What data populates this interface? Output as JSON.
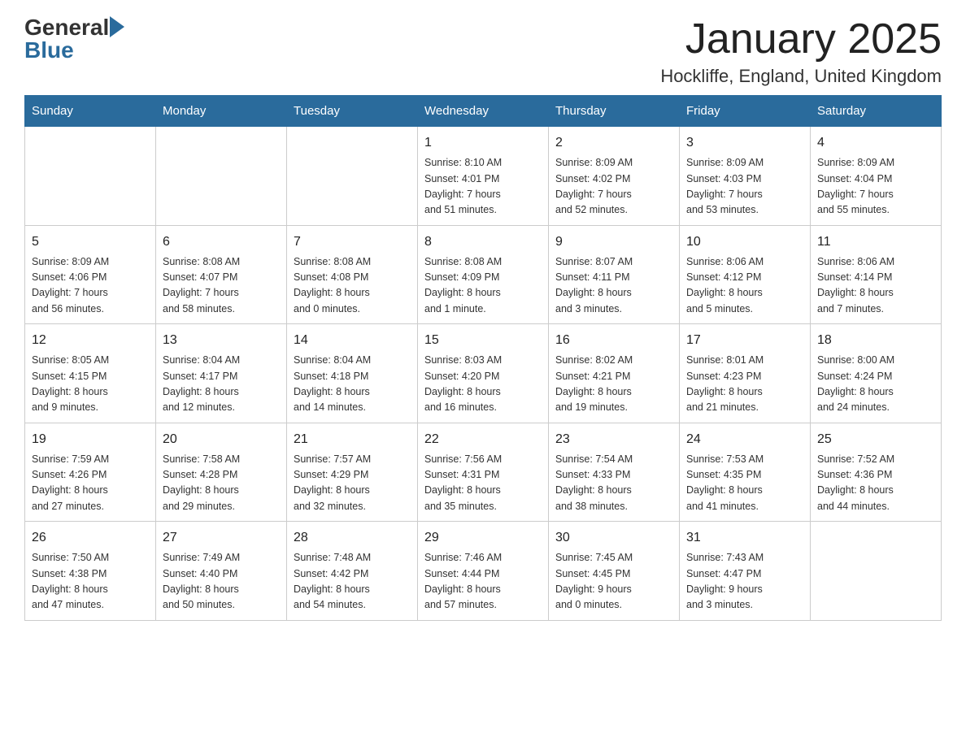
{
  "logo": {
    "general": "General",
    "blue": "Blue"
  },
  "title": "January 2025",
  "location": "Hockliffe, England, United Kingdom",
  "weekdays": [
    "Sunday",
    "Monday",
    "Tuesday",
    "Wednesday",
    "Thursday",
    "Friday",
    "Saturday"
  ],
  "weeks": [
    [
      {
        "day": "",
        "info": ""
      },
      {
        "day": "",
        "info": ""
      },
      {
        "day": "",
        "info": ""
      },
      {
        "day": "1",
        "info": "Sunrise: 8:10 AM\nSunset: 4:01 PM\nDaylight: 7 hours\nand 51 minutes."
      },
      {
        "day": "2",
        "info": "Sunrise: 8:09 AM\nSunset: 4:02 PM\nDaylight: 7 hours\nand 52 minutes."
      },
      {
        "day": "3",
        "info": "Sunrise: 8:09 AM\nSunset: 4:03 PM\nDaylight: 7 hours\nand 53 minutes."
      },
      {
        "day": "4",
        "info": "Sunrise: 8:09 AM\nSunset: 4:04 PM\nDaylight: 7 hours\nand 55 minutes."
      }
    ],
    [
      {
        "day": "5",
        "info": "Sunrise: 8:09 AM\nSunset: 4:06 PM\nDaylight: 7 hours\nand 56 minutes."
      },
      {
        "day": "6",
        "info": "Sunrise: 8:08 AM\nSunset: 4:07 PM\nDaylight: 7 hours\nand 58 minutes."
      },
      {
        "day": "7",
        "info": "Sunrise: 8:08 AM\nSunset: 4:08 PM\nDaylight: 8 hours\nand 0 minutes."
      },
      {
        "day": "8",
        "info": "Sunrise: 8:08 AM\nSunset: 4:09 PM\nDaylight: 8 hours\nand 1 minute."
      },
      {
        "day": "9",
        "info": "Sunrise: 8:07 AM\nSunset: 4:11 PM\nDaylight: 8 hours\nand 3 minutes."
      },
      {
        "day": "10",
        "info": "Sunrise: 8:06 AM\nSunset: 4:12 PM\nDaylight: 8 hours\nand 5 minutes."
      },
      {
        "day": "11",
        "info": "Sunrise: 8:06 AM\nSunset: 4:14 PM\nDaylight: 8 hours\nand 7 minutes."
      }
    ],
    [
      {
        "day": "12",
        "info": "Sunrise: 8:05 AM\nSunset: 4:15 PM\nDaylight: 8 hours\nand 9 minutes."
      },
      {
        "day": "13",
        "info": "Sunrise: 8:04 AM\nSunset: 4:17 PM\nDaylight: 8 hours\nand 12 minutes."
      },
      {
        "day": "14",
        "info": "Sunrise: 8:04 AM\nSunset: 4:18 PM\nDaylight: 8 hours\nand 14 minutes."
      },
      {
        "day": "15",
        "info": "Sunrise: 8:03 AM\nSunset: 4:20 PM\nDaylight: 8 hours\nand 16 minutes."
      },
      {
        "day": "16",
        "info": "Sunrise: 8:02 AM\nSunset: 4:21 PM\nDaylight: 8 hours\nand 19 minutes."
      },
      {
        "day": "17",
        "info": "Sunrise: 8:01 AM\nSunset: 4:23 PM\nDaylight: 8 hours\nand 21 minutes."
      },
      {
        "day": "18",
        "info": "Sunrise: 8:00 AM\nSunset: 4:24 PM\nDaylight: 8 hours\nand 24 minutes."
      }
    ],
    [
      {
        "day": "19",
        "info": "Sunrise: 7:59 AM\nSunset: 4:26 PM\nDaylight: 8 hours\nand 27 minutes."
      },
      {
        "day": "20",
        "info": "Sunrise: 7:58 AM\nSunset: 4:28 PM\nDaylight: 8 hours\nand 29 minutes."
      },
      {
        "day": "21",
        "info": "Sunrise: 7:57 AM\nSunset: 4:29 PM\nDaylight: 8 hours\nand 32 minutes."
      },
      {
        "day": "22",
        "info": "Sunrise: 7:56 AM\nSunset: 4:31 PM\nDaylight: 8 hours\nand 35 minutes."
      },
      {
        "day": "23",
        "info": "Sunrise: 7:54 AM\nSunset: 4:33 PM\nDaylight: 8 hours\nand 38 minutes."
      },
      {
        "day": "24",
        "info": "Sunrise: 7:53 AM\nSunset: 4:35 PM\nDaylight: 8 hours\nand 41 minutes."
      },
      {
        "day": "25",
        "info": "Sunrise: 7:52 AM\nSunset: 4:36 PM\nDaylight: 8 hours\nand 44 minutes."
      }
    ],
    [
      {
        "day": "26",
        "info": "Sunrise: 7:50 AM\nSunset: 4:38 PM\nDaylight: 8 hours\nand 47 minutes."
      },
      {
        "day": "27",
        "info": "Sunrise: 7:49 AM\nSunset: 4:40 PM\nDaylight: 8 hours\nand 50 minutes."
      },
      {
        "day": "28",
        "info": "Sunrise: 7:48 AM\nSunset: 4:42 PM\nDaylight: 8 hours\nand 54 minutes."
      },
      {
        "day": "29",
        "info": "Sunrise: 7:46 AM\nSunset: 4:44 PM\nDaylight: 8 hours\nand 57 minutes."
      },
      {
        "day": "30",
        "info": "Sunrise: 7:45 AM\nSunset: 4:45 PM\nDaylight: 9 hours\nand 0 minutes."
      },
      {
        "day": "31",
        "info": "Sunrise: 7:43 AM\nSunset: 4:47 PM\nDaylight: 9 hours\nand 3 minutes."
      },
      {
        "day": "",
        "info": ""
      }
    ]
  ]
}
